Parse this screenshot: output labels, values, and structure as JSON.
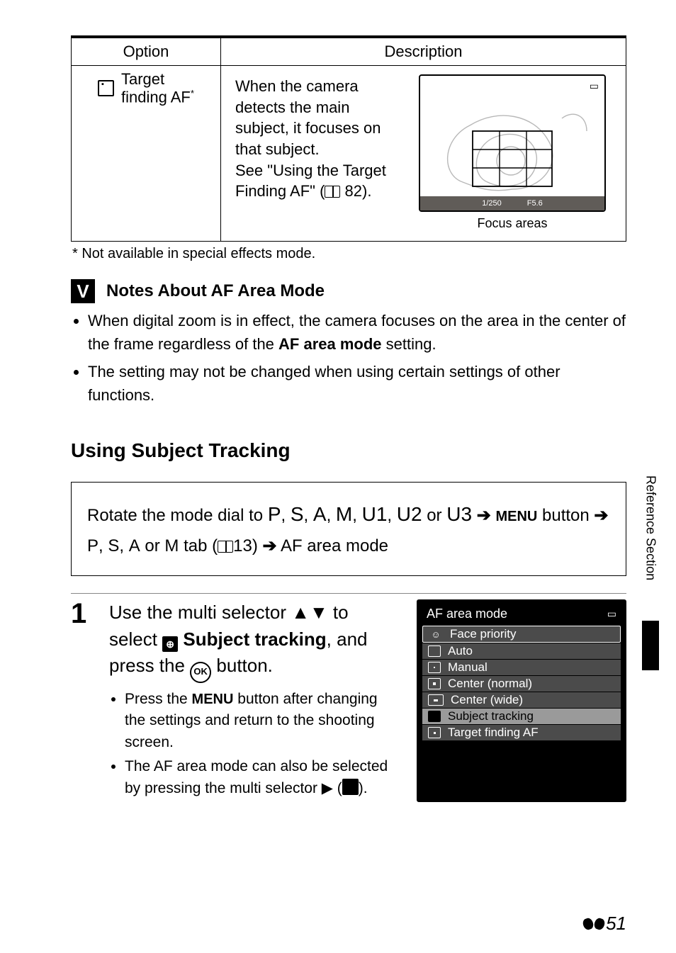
{
  "table": {
    "headers": [
      "Option",
      "Description"
    ],
    "option": {
      "label_line1": "Target",
      "label_line2": "finding AF",
      "sup": "*"
    },
    "desc": {
      "line1": "When the camera detects the main subject, it focuses on that subject.",
      "line2a": "See \"Using the Target Finding AF\" (",
      "line2b": " 82)."
    },
    "illus": {
      "shutter": "1/250",
      "fstop": "F5.6",
      "caption": "Focus areas"
    }
  },
  "footnote": "*  Not available in special effects mode.",
  "notes": {
    "title": "Notes About AF Area Mode",
    "items": [
      {
        "pre": "When digital zoom is in effect, the camera focuses on the area in the center of the frame regardless of the ",
        "bold": "AF area mode",
        "post": " setting."
      },
      {
        "pre": "The setting may not be changed when using certain settings of other functions.",
        "bold": "",
        "post": ""
      }
    ]
  },
  "subject_heading": "Using Subject Tracking",
  "navbox": {
    "a": "Rotate the mode dial to ",
    "modes": [
      "P",
      "S",
      "A",
      "M",
      "U1",
      "U2",
      "U3"
    ],
    "menu": "MENU",
    "btn": " button ",
    "b": " tab (",
    "ref": "13",
    "c": ") ",
    "d": " AF area mode"
  },
  "step": {
    "num": "1",
    "title_a": "Use the multi selector ",
    "title_b": " to select ",
    "title_bold": "Subject tracking",
    "title_c": ", and press the ",
    "title_d": " button.",
    "ok": "OK",
    "bullets": [
      {
        "a": "Press the ",
        "menu": "MENU",
        "b": " button after changing the settings and return to the shooting screen."
      },
      {
        "a": "The AF area mode can also be selected by pressing the multi selector ",
        "b": " (",
        "c": ")."
      }
    ]
  },
  "menu_panel": {
    "title": "AF area mode",
    "items": [
      "Face priority",
      "Auto",
      "Manual",
      "Center (normal)",
      "Center (wide)",
      "Subject tracking",
      "Target finding AF"
    ],
    "selected_index": 5
  },
  "side_tab": "Reference Section",
  "page_number": "51"
}
